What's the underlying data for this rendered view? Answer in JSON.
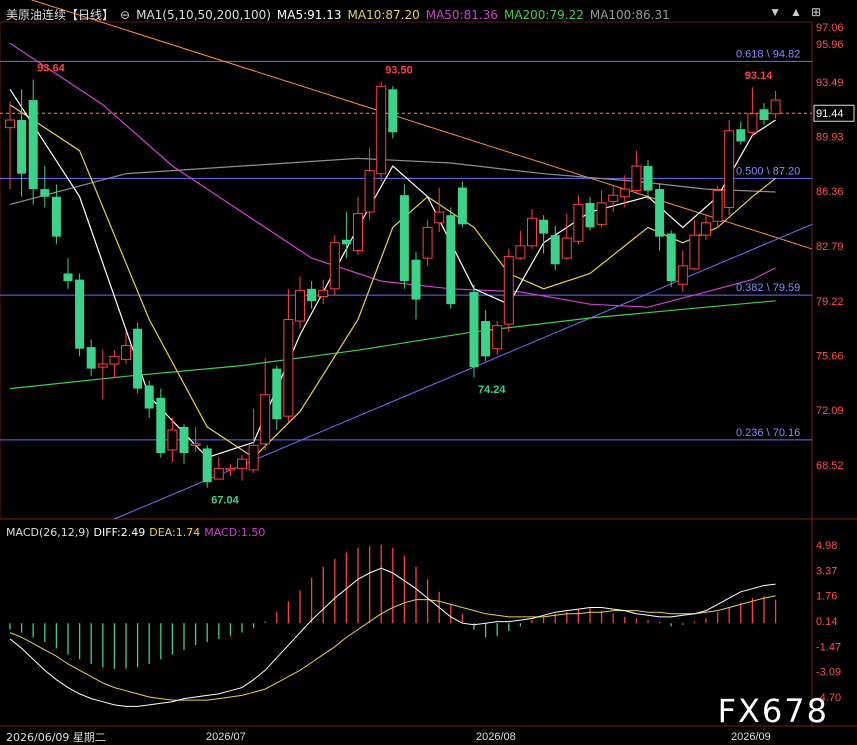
{
  "header": {
    "title": "美原油连续",
    "period": "【日线】",
    "ma_def": "MA1(5,10,50,200,100)",
    "ma5": "MA5:91.13",
    "ma10": "MA10:87.20",
    "ma50": "MA50:81.36",
    "ma200": "MA200:79.22",
    "ma100": "MA100:86.31"
  },
  "toolbar": {
    "down_icon": "▼",
    "up_icon": "▲",
    "expand_icon": "⊞"
  },
  "macd_header": {
    "name": "MACD(26,12,9)",
    "diff": "DIFF:2.49",
    "dea": "DEA:1.74",
    "macd": "MACD:1.50"
  },
  "footer": {
    "date": "2026/06/09 星期二"
  },
  "watermark": "FX678",
  "colors": {
    "up": "#ff4040",
    "down": "#3cd28a",
    "ma5": "#ffffff",
    "ma10": "#e6d24a",
    "ma50": "#d040d0",
    "ma200": "#3fd04f",
    "ma100": "#8f8f8f",
    "fib": "#6a6aff",
    "trend_down": "#ff8c40",
    "trend_up": "#7070ff"
  },
  "chart_data": {
    "type": "candlestick",
    "price_axis": [
      "97.06",
      "95.96",
      "93.49",
      "91.44",
      "89.93",
      "86.36",
      "82.79",
      "79.22",
      "75.66",
      "72.09",
      "68.52"
    ],
    "current_price": "91.44",
    "time_labels": [
      "2026/07",
      "2026/08",
      "2026/09"
    ],
    "fib_levels": [
      {
        "label": "0.618 \\ 94.82",
        "value": 94.82
      },
      {
        "label": "0.500 \\ 87.20",
        "value": 87.2
      },
      {
        "label": "0.382 \\ 79.59",
        "value": 79.59
      },
      {
        "label": "0.236 \\ 70.16",
        "value": 70.16
      }
    ],
    "annotations": [
      {
        "text": "93.64",
        "value": 93.64,
        "bar": 2,
        "kind": "high"
      },
      {
        "text": "93.50",
        "value": 93.5,
        "bar": 32,
        "kind": "high"
      },
      {
        "text": "93.14",
        "value": 93.14,
        "bar": 63,
        "kind": "high"
      },
      {
        "text": "67.04",
        "value": 67.04,
        "bar": 17,
        "kind": "low"
      },
      {
        "text": "74.24",
        "value": 74.24,
        "bar": 40,
        "kind": "low"
      }
    ],
    "candles": [
      [
        90.5,
        91.0,
        92.2,
        86.5
      ],
      [
        91.0,
        87.5,
        93.0,
        86.0
      ],
      [
        92.3,
        86.5,
        93.64,
        85.5
      ],
      [
        86.5,
        86.0,
        88.0,
        85.3
      ],
      [
        86.0,
        83.4,
        86.8,
        82.9
      ],
      [
        81.0,
        80.5,
        82.0,
        80.0
      ],
      [
        80.6,
        76.1,
        81.0,
        75.6
      ],
      [
        76.2,
        74.8,
        76.7,
        74.3
      ],
      [
        74.9,
        75.1,
        76.0,
        72.8
      ],
      [
        75.1,
        75.6,
        76.0,
        74.2
      ],
      [
        75.4,
        76.3,
        77.2,
        75.1
      ],
      [
        77.4,
        73.5,
        77.8,
        73.2
      ],
      [
        73.7,
        72.2,
        74.0,
        71.6
      ],
      [
        72.9,
        69.3,
        73.5,
        69.0
      ],
      [
        69.5,
        70.8,
        71.6,
        68.7
      ],
      [
        71.0,
        69.3,
        71.2,
        68.6
      ],
      [
        69.8,
        69.9,
        71.0,
        69.4
      ],
      [
        69.6,
        67.4,
        69.8,
        67.04
      ],
      [
        67.6,
        68.3,
        69.0,
        67.6
      ],
      [
        68.2,
        68.3,
        68.6,
        67.8
      ],
      [
        68.3,
        68.9,
        69.2,
        67.5
      ],
      [
        68.2,
        69.8,
        72.2,
        68.0
      ],
      [
        69.9,
        73.1,
        75.5,
        69.5
      ],
      [
        74.8,
        71.5,
        75.0,
        70.8
      ],
      [
        71.7,
        78.0,
        80.0,
        71.3
      ],
      [
        77.9,
        79.9,
        80.8,
        77.4
      ],
      [
        80.0,
        79.2,
        80.5,
        78.7
      ],
      [
        79.5,
        79.9,
        80.6,
        79.0
      ],
      [
        80.0,
        83.0,
        83.5,
        79.6
      ],
      [
        83.2,
        82.9,
        85.0,
        82.0
      ],
      [
        82.5,
        84.9,
        86.0,
        82.2
      ],
      [
        85.0,
        87.7,
        89.2,
        84.5
      ],
      [
        87.5,
        93.2,
        93.5,
        87.0
      ],
      [
        93.0,
        90.2,
        93.2,
        89.8
      ],
      [
        86.1,
        80.5,
        86.8,
        80.0
      ],
      [
        81.9,
        79.3,
        82.4,
        78.0
      ],
      [
        82.0,
        84.0,
        84.5,
        81.5
      ],
      [
        84.3,
        85.0,
        86.6,
        83.7
      ],
      [
        84.8,
        79.0,
        85.3,
        78.7
      ],
      [
        86.6,
        84.2,
        87.0,
        84.0
      ],
      [
        79.8,
        74.9,
        80.3,
        74.24
      ],
      [
        77.9,
        75.6,
        78.6,
        75.3
      ],
      [
        76.1,
        77.6,
        77.9,
        75.7
      ],
      [
        77.7,
        82.1,
        82.6,
        77.2
      ],
      [
        82.0,
        82.8,
        83.8,
        81.9
      ],
      [
        82.8,
        84.6,
        85.2,
        82.6
      ],
      [
        84.5,
        83.6,
        84.8,
        82.3
      ],
      [
        83.5,
        81.6,
        84.1,
        81.2
      ],
      [
        82.0,
        83.3,
        84.9,
        81.9
      ],
      [
        83.1,
        85.5,
        86.1,
        82.9
      ],
      [
        85.6,
        84.0,
        86.0,
        83.8
      ],
      [
        84.2,
        85.6,
        86.4,
        84.0
      ],
      [
        85.7,
        86.1,
        86.7,
        85.0
      ],
      [
        86.0,
        86.5,
        87.4,
        85.3
      ],
      [
        86.4,
        88.0,
        89.0,
        86.2
      ],
      [
        88.0,
        86.4,
        88.4,
        85.8
      ],
      [
        86.5,
        83.4,
        86.9,
        82.5
      ],
      [
        83.6,
        80.5,
        83.8,
        80.1
      ],
      [
        80.3,
        81.5,
        82.5,
        79.8
      ],
      [
        81.3,
        83.5,
        84.5,
        81.2
      ],
      [
        83.5,
        84.3,
        84.8,
        83.2
      ],
      [
        84.4,
        86.4,
        86.7,
        84.0
      ],
      [
        85.3,
        90.3,
        91.0,
        84.8
      ],
      [
        90.4,
        89.6,
        90.9,
        89.4
      ],
      [
        90.2,
        91.4,
        93.14,
        90.0
      ],
      [
        91.7,
        91.0,
        92.1,
        90.7
      ],
      [
        91.4,
        92.3,
        92.9,
        91.1
      ]
    ],
    "ma5_pts": [
      [
        0,
        93
      ],
      [
        6,
        86
      ],
      [
        12,
        73
      ],
      [
        17,
        69
      ],
      [
        21,
        70
      ],
      [
        25,
        77
      ],
      [
        30,
        84
      ],
      [
        33,
        88
      ],
      [
        36,
        86
      ],
      [
        40,
        80
      ],
      [
        43,
        79
      ],
      [
        46,
        83
      ],
      [
        50,
        85
      ],
      [
        55,
        86
      ],
      [
        58,
        84
      ],
      [
        61,
        86
      ],
      [
        64,
        90
      ],
      [
        66,
        91
      ]
    ],
    "ma10_pts": [
      [
        0,
        92
      ],
      [
        6,
        89
      ],
      [
        12,
        78
      ],
      [
        17,
        71
      ],
      [
        21,
        69
      ],
      [
        25,
        72
      ],
      [
        30,
        78
      ],
      [
        33,
        84
      ],
      [
        36,
        86
      ],
      [
        40,
        84
      ],
      [
        43,
        81
      ],
      [
        46,
        80
      ],
      [
        50,
        81
      ],
      [
        55,
        84
      ],
      [
        58,
        83
      ],
      [
        61,
        84
      ],
      [
        64,
        86
      ],
      [
        66,
        87.2
      ]
    ],
    "ma50_pts": [
      [
        0,
        96
      ],
      [
        8,
        92
      ],
      [
        14,
        88
      ],
      [
        20,
        85
      ],
      [
        26,
        82
      ],
      [
        32,
        80.5
      ],
      [
        38,
        80
      ],
      [
        44,
        79.8
      ],
      [
        50,
        79
      ],
      [
        55,
        78.8
      ],
      [
        60,
        79.8
      ],
      [
        64,
        80.6
      ],
      [
        66,
        81.36
      ]
    ],
    "ma100_pts": [
      [
        0,
        85.5
      ],
      [
        10,
        87.5
      ],
      [
        20,
        88.0
      ],
      [
        30,
        88.5
      ],
      [
        38,
        88.2
      ],
      [
        46,
        87.5
      ],
      [
        54,
        87
      ],
      [
        60,
        86.5
      ],
      [
        66,
        86.31
      ]
    ],
    "ma200_pts": [
      [
        0,
        73.5
      ],
      [
        10,
        74.3
      ],
      [
        20,
        75.0
      ],
      [
        30,
        76.0
      ],
      [
        40,
        77.2
      ],
      [
        50,
        78.1
      ],
      [
        60,
        78.8
      ],
      [
        66,
        79.22
      ]
    ],
    "macd": {
      "axis": [
        "4.98",
        "3.37",
        "1.76",
        "0.14",
        "-1.47",
        "-3.09",
        "-4.70"
      ],
      "hist": [
        -0.4,
        -0.6,
        -0.9,
        -1.2,
        -1.6,
        -2.0,
        -2.3,
        -2.6,
        -2.8,
        -2.9,
        -2.9,
        -2.8,
        -2.6,
        -2.3,
        -2.0,
        -1.7,
        -1.4,
        -1.2,
        -1.0,
        -0.8,
        -0.6,
        -0.3,
        0.1,
        0.7,
        1.4,
        2.1,
        2.9,
        3.6,
        4.1,
        4.5,
        4.8,
        4.9,
        5.0,
        4.8,
        4.3,
        3.6,
        2.8,
        2.0,
        1.2,
        0.6,
        -0.4,
        -0.9,
        -0.8,
        -0.5,
        -0.2,
        0.2,
        0.4,
        0.6,
        0.7,
        0.9,
        1.0,
        0.8,
        0.6,
        0.4,
        0.3,
        0.2,
        0.1,
        -0.2,
        -0.1,
        0.1,
        0.3,
        0.7,
        1.0,
        1.3,
        1.6,
        1.7,
        1.5
      ],
      "diff": [
        -1.0,
        -1.6,
        -2.3,
        -3.0,
        -3.6,
        -4.1,
        -4.5,
        -4.8,
        -5.0,
        -5.2,
        -5.3,
        -5.3,
        -5.2,
        -5.1,
        -5.0,
        -4.8,
        -4.7,
        -4.6,
        -4.5,
        -4.3,
        -4.1,
        -3.6,
        -3.0,
        -2.2,
        -1.4,
        -0.6,
        0.2,
        0.9,
        1.6,
        2.2,
        2.8,
        3.2,
        3.5,
        3.2,
        2.7,
        2.2,
        1.6,
        1.0,
        0.4,
        0.0,
        -0.1,
        0.0,
        0.1,
        0.1,
        0.2,
        0.3,
        0.5,
        0.7,
        0.8,
        0.9,
        1.0,
        1.0,
        0.9,
        0.8,
        0.6,
        0.5,
        0.4,
        0.4,
        0.5,
        0.6,
        0.8,
        1.2,
        1.6,
        2.0,
        2.2,
        2.4,
        2.49
      ],
      "dea": [
        -0.6,
        -0.9,
        -1.3,
        -1.7,
        -2.1,
        -2.6,
        -3.0,
        -3.4,
        -3.8,
        -4.1,
        -4.3,
        -4.5,
        -4.7,
        -4.8,
        -4.9,
        -4.9,
        -4.9,
        -4.9,
        -4.8,
        -4.7,
        -4.6,
        -4.4,
        -4.2,
        -3.8,
        -3.4,
        -3.0,
        -2.5,
        -2.0,
        -1.5,
        -0.9,
        -0.4,
        0.1,
        0.6,
        1.0,
        1.3,
        1.5,
        1.5,
        1.4,
        1.2,
        1.0,
        0.8,
        0.6,
        0.5,
        0.4,
        0.4,
        0.4,
        0.4,
        0.5,
        0.6,
        0.6,
        0.7,
        0.7,
        0.8,
        0.8,
        0.8,
        0.7,
        0.7,
        0.6,
        0.6,
        0.6,
        0.7,
        0.8,
        1.0,
        1.2,
        1.4,
        1.6,
        1.74
      ]
    }
  }
}
